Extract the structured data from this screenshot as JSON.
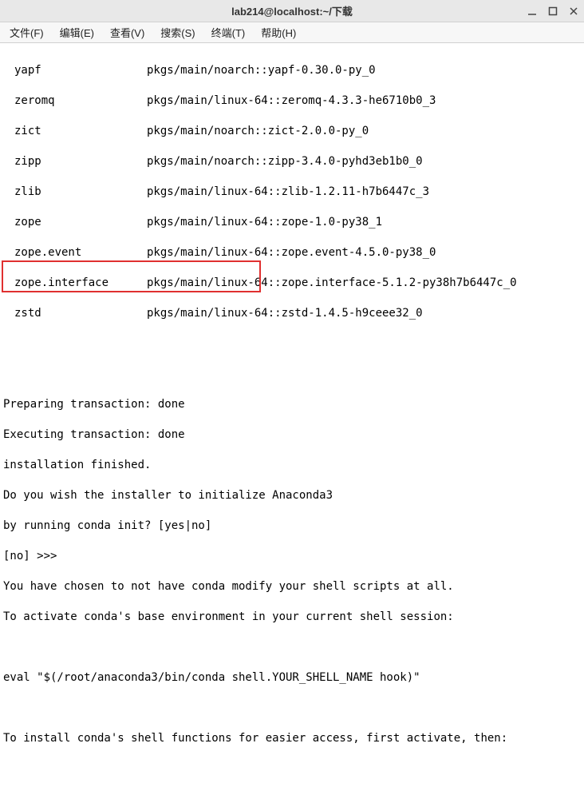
{
  "window": {
    "title": "lab214@localhost:~/下载"
  },
  "menu": {
    "file": "文件(F)",
    "edit": "编辑(E)",
    "view": "查看(V)",
    "search": "搜索(S)",
    "terminal": "终端(T)",
    "help": "帮助(H)"
  },
  "packages": [
    {
      "name": "yapf",
      "spec": "pkgs/main/noarch::yapf-0.30.0-py_0"
    },
    {
      "name": "zeromq",
      "spec": "pkgs/main/linux-64::zeromq-4.3.3-he6710b0_3"
    },
    {
      "name": "zict",
      "spec": "pkgs/main/noarch::zict-2.0.0-py_0"
    },
    {
      "name": "zipp",
      "spec": "pkgs/main/noarch::zipp-3.4.0-pyhd3eb1b0_0"
    },
    {
      "name": "zlib",
      "spec": "pkgs/main/linux-64::zlib-1.2.11-h7b6447c_3"
    },
    {
      "name": "zope",
      "spec": "pkgs/main/linux-64::zope-1.0-py38_1"
    },
    {
      "name": "zope.event",
      "spec": "pkgs/main/linux-64::zope.event-4.5.0-py38_0"
    },
    {
      "name": "zope.interface",
      "spec": "pkgs/main/linux-64::zope.interface-5.1.2-py38h7b6447c_0"
    },
    {
      "name": "zstd",
      "spec": "pkgs/main/linux-64::zstd-1.4.5-h9ceee32_0"
    }
  ],
  "lines": {
    "prep": "Preparing transaction: done",
    "exec": "Executing transaction: done",
    "instfin": "installation finished.",
    "wish": "Do you wish the installer to initialize Anaconda3",
    "byrun": "by running conda init? [yes|no]",
    "prompt": "[no] >>> ",
    "chosen": "You have chosen to not have conda modify your shell scripts at all.",
    "activate": "To activate conda's base environment in your current shell session:",
    "eval": "eval \"$(/root/anaconda3/bin/conda shell.YOUR_SHELL_NAME hook)\"",
    "install": "To install conda's shell functions for easier access, first activate, then:"
  }
}
